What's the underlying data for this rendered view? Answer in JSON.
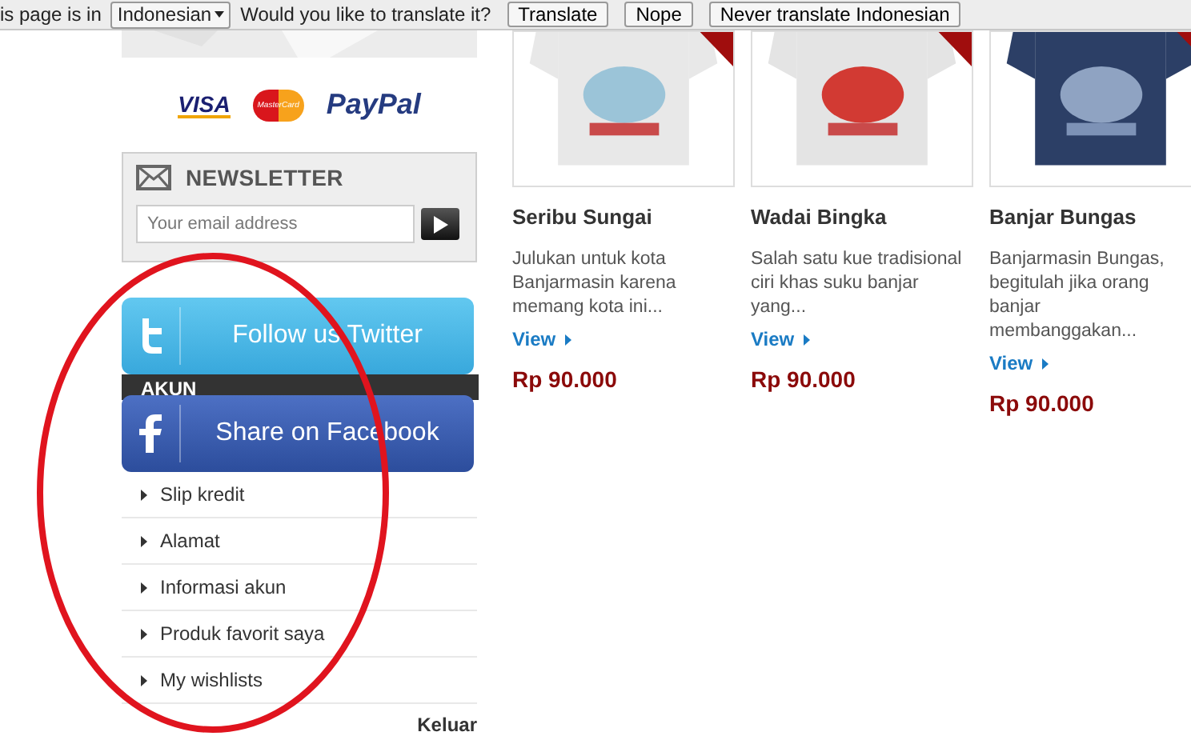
{
  "translate_bar": {
    "message": "is page is in",
    "language": "Indonesian",
    "question": "Would you like to translate it?",
    "buttons": [
      "Translate",
      "Nope",
      "Never translate Indonesian"
    ]
  },
  "sidebar": {
    "payment_logos": [
      "VISA",
      "MasterCard",
      "PayPal"
    ],
    "newsletter": {
      "title": "NEWSLETTER",
      "placeholder": "Your email address"
    },
    "social_buttons": [
      {
        "kind": "twitter",
        "label": "Follow us Twitter"
      },
      {
        "kind": "facebook",
        "label": "Share on Facebook"
      }
    ],
    "account": {
      "title": "AKUN",
      "items": [
        "Slip kredit",
        "Alamat",
        "Informasi akun",
        "Produk favorit saya",
        "My wishlists"
      ],
      "logout": "Keluar"
    }
  },
  "products": [
    {
      "name": "Seribu Sungai",
      "description": "Julukan untuk kota Banjarmasin karena memang  kota ini...",
      "link": "View",
      "price": "Rp 90.000"
    },
    {
      "name": "Wadai Bingka",
      "description": "Salah satu kue tradisional ciri khas suku banjar yang...",
      "link": "View",
      "price": "Rp 90.000"
    },
    {
      "name": "Banjar Bungas",
      "description": "Banjarmasin Bungas, begitulah jika orang  banjar membanggakan...",
      "link": "View",
      "price": "Rp 90.000"
    }
  ]
}
